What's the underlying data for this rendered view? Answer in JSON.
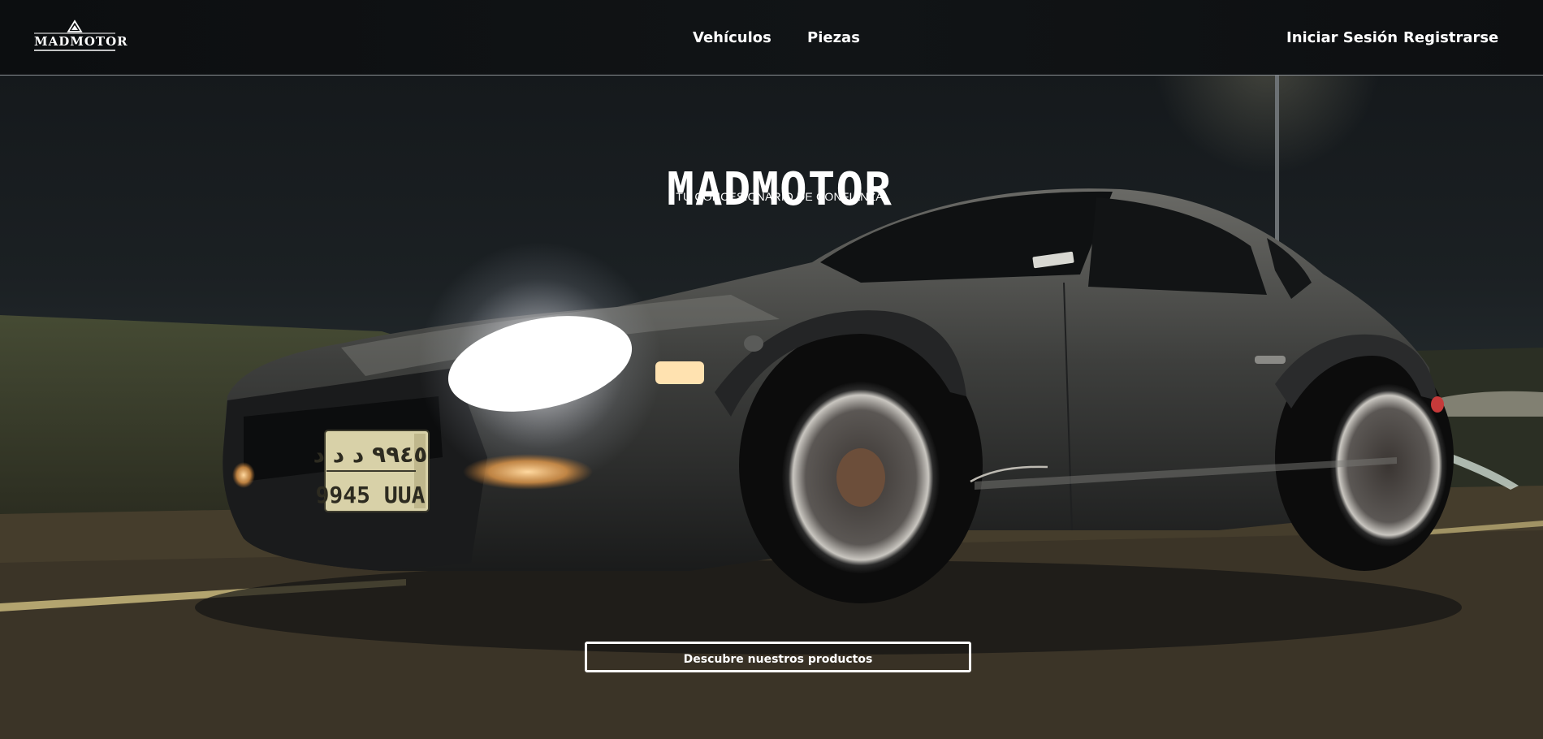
{
  "header": {
    "logo_text": "MADMOTOR",
    "nav": {
      "vehicles": "Vehículos",
      "parts": "Piezas"
    },
    "account": {
      "login": "Iniciar Sesión",
      "register": "Registrarse"
    }
  },
  "hero": {
    "title": "MADMOTOR",
    "subtitle": "TU CONCESIONARIO DE CONFIANZA",
    "cta_label": "Descubre nuestros productos",
    "license_plate": {
      "top": "٩٩٤٥ د د د",
      "bottom": "9945 UUA"
    }
  },
  "colors": {
    "header_bg": "#0f1214",
    "text": "#ffffff",
    "header_divider": "#8a8f93"
  }
}
